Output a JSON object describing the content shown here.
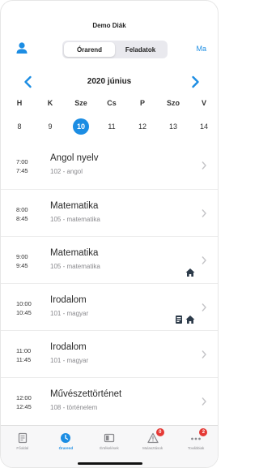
{
  "header": {
    "title": "Demo Diák",
    "segments": [
      "Órarend",
      "Feladatok"
    ],
    "active_segment": 0,
    "today_label": "Ma"
  },
  "calendar": {
    "month_label": "2020 június",
    "weekdays": [
      "H",
      "K",
      "Sze",
      "Cs",
      "P",
      "Szo",
      "V"
    ],
    "dates": [
      "8",
      "9",
      "10",
      "11",
      "12",
      "13",
      "14"
    ],
    "selected_index": 2
  },
  "lessons": [
    {
      "start": "7:00",
      "end": "7:45",
      "subject": "Angol nyelv",
      "room": "102 - angol",
      "badges": []
    },
    {
      "start": "8:00",
      "end": "8:45",
      "subject": "Matematika",
      "room": "105 - matematika",
      "badges": []
    },
    {
      "start": "9:00",
      "end": "9:45",
      "subject": "Matematika",
      "room": "105 - matematika",
      "badges": [
        "home-icon"
      ]
    },
    {
      "start": "10:00",
      "end": "10:45",
      "subject": "Irodalom",
      "room": "101 - magyar",
      "badges": [
        "homework-icon",
        "home-icon"
      ]
    },
    {
      "start": "11:00",
      "end": "11:45",
      "subject": "Irodalom",
      "room": "101 - magyar",
      "badges": []
    },
    {
      "start": "12:00",
      "end": "12:45",
      "subject": "Művészettörténet",
      "room": "108 - történelem",
      "badges": []
    }
  ],
  "tabbar": {
    "items": [
      {
        "label": "Főoldal",
        "icon": "home-card-icon",
        "badge": ""
      },
      {
        "label": "Órarend",
        "icon": "clock-icon",
        "badge": ""
      },
      {
        "label": "Értékelések",
        "icon": "grades-icon",
        "badge": ""
      },
      {
        "label": "Mulasztások",
        "icon": "warning-icon",
        "badge": "0"
      },
      {
        "label": "Továbbiak",
        "icon": "more-icon",
        "badge": "2"
      }
    ],
    "active_index": 1
  },
  "colors": {
    "accent": "#1c8de3",
    "badge": "#e53935",
    "text": "#2a2a2a",
    "secondary": "#8a8a8e"
  }
}
